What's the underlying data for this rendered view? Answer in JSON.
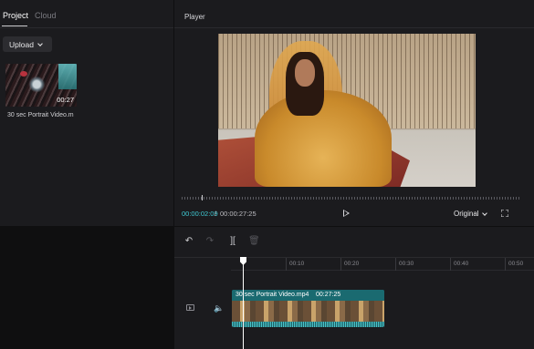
{
  "left_panel": {
    "tabs": [
      {
        "label": "Project",
        "active": true
      },
      {
        "label": "Cloud",
        "active": false
      }
    ],
    "upload_label": "Upload",
    "media": [
      {
        "name": "30 sec Portrait Video.m",
        "duration": "00:27"
      }
    ]
  },
  "player": {
    "title": "Player",
    "time_current": "00:00:02:09",
    "time_separator": "/",
    "time_total": "00:00:27:25",
    "ratio_label": "Original"
  },
  "timeline": {
    "tools": [
      "undo-icon",
      "redo-icon",
      "split-icon",
      "delete-icon"
    ],
    "ruler_ticks": [
      "00:10",
      "00:20",
      "00:30",
      "00:40",
      "00:50"
    ],
    "clip": {
      "name": "30 sec Portrait Video.mp4",
      "duration": "00:27:25"
    }
  },
  "colors": {
    "accent": "#3fc9d3",
    "clip_bg": "#1d5e63",
    "panel_bg": "#1b1b1e",
    "app_bg": "#0f0f10"
  }
}
